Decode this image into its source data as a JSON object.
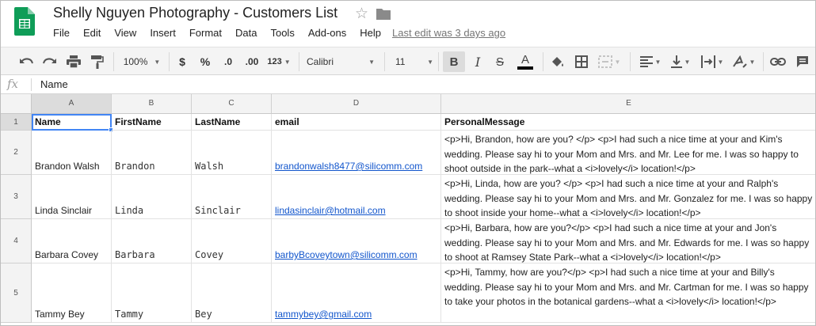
{
  "doc": {
    "title": "Shelly Nguyen Photography - Customers List",
    "last_edit": "Last edit was 3 days ago"
  },
  "menu": [
    "File",
    "Edit",
    "View",
    "Insert",
    "Format",
    "Data",
    "Tools",
    "Add-ons",
    "Help"
  ],
  "toolbar": {
    "zoom": "100%",
    "currency": "$",
    "percent": "%",
    "decrease_decimal": ".0",
    "increase_decimal": ".00",
    "more_formats": "123",
    "font": "Calibri",
    "font_size": "11",
    "bold": "B",
    "italic": "I",
    "strikethrough": "S",
    "text_color": "A",
    "text_color_value": "#000000"
  },
  "formula_bar": {
    "fx": "fx",
    "value": "Name"
  },
  "columns": [
    "A",
    "B",
    "C",
    "D",
    "E"
  ],
  "rows": [
    "1",
    "2",
    "3",
    "4",
    "5"
  ],
  "header": [
    "Name",
    "FirstName",
    "LastName",
    "email",
    "PersonalMessage"
  ],
  "records": [
    {
      "name": "Brandon Walsh",
      "first": "Brandon",
      "last": "Walsh",
      "email": "brandonwalsh8477@silicomm.com",
      "message": "<p>Hi, Brandon, how are you? </p> <p>I had such a nice time at your and Kim's wedding. Please say hi to your Mom and Mrs. and Mr. Lee for me. I was so happy to shoot outside in the park--what a <i>lovely</i> location!</p>"
    },
    {
      "name": "Linda Sinclair",
      "first": "Linda",
      "last": "Sinclair",
      "email": "lindasinclair@hotmail.com",
      "message": "<p>Hi, Linda, how are you? </p> <p>I had such a nice time at your and Ralph's wedding. Please say hi to your Mom and Mrs. and Mr. Gonzalez for me. I was so happy to shoot inside your home--what a <i>lovely</i> location!</p>"
    },
    {
      "name": "Barbara Covey",
      "first": "Barbara",
      "last": "Covey",
      "email": "barbyBcoveytown@silicomm.com",
      "message": "<p>Hi, Barbara, how are you?</p> <p>I had such a nice time at your and Jon's wedding. Please say hi to your Mom and Mrs. and Mr. Edwards for me. I was so happy to shoot at Ramsey State Park--what a <i>lovely</i> location!</p>"
    },
    {
      "name": "Tammy Bey",
      "first": "Tammy",
      "last": "Bey",
      "email": "tammybey@gmail.com",
      "message": "<p>Hi, Tammy, how are you?</p> <p>I had such a nice time at your and Billy's wedding. Please say hi to your Mom and Mrs. and Mr. Cartman for me. I was so happy to take your photos in the botanical gardens--what a <i>lovely</i> location!</p>"
    }
  ],
  "colors": {
    "accent": "#4285f4",
    "link": "#1155cc",
    "sheets_green": "#0f9d58"
  }
}
